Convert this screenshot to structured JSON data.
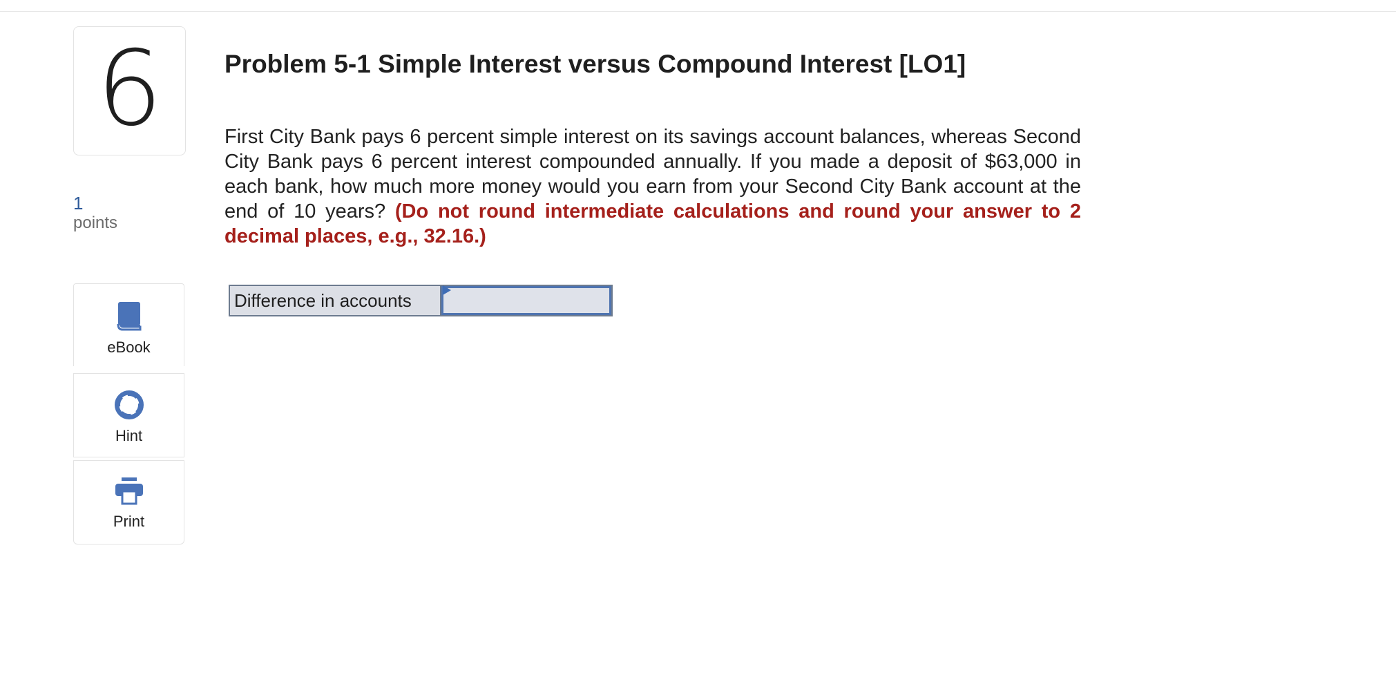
{
  "question": {
    "number": "6",
    "points_value": "1",
    "points_label": "points",
    "title": "Problem 5-1 Simple Interest versus Compound Interest [LO1]",
    "text": "First City Bank pays 6 percent simple interest on its savings account balances, whereas Second City Bank pays 6 percent interest compounded annually. If you made a deposit of $63,000 in each bank, how much more money would you earn from your Second City Bank account at the end of 10 years? ",
    "instruction": "(Do not round intermediate calculations and round your answer to 2 decimal places, e.g., 32.16.)"
  },
  "tools": {
    "ebook_label": "eBook",
    "hint_label": "Hint",
    "print_label": "Print"
  },
  "answer": {
    "label": "Difference in accounts",
    "value": ""
  },
  "colors": {
    "accent": "#4a73b8",
    "emphasis": "#a5201b"
  }
}
